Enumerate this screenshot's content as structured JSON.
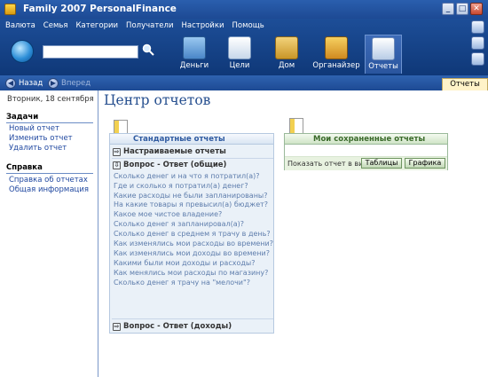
{
  "window": {
    "title": "Family 2007 PersonalFinance"
  },
  "menu": [
    "Валюта",
    "Семья",
    "Категории",
    "Получатели",
    "Настройки",
    "Помощь"
  ],
  "nav": [
    {
      "label": "Деньги",
      "icon": "money-icon"
    },
    {
      "label": "Цели",
      "icon": "goals-icon"
    },
    {
      "label": "Дом",
      "icon": "home-icon"
    },
    {
      "label": "Органайзер",
      "icon": "organizer-icon"
    },
    {
      "label": "Отчеты",
      "icon": "reports-icon",
      "active": true
    }
  ],
  "toolbar": {
    "back": "Назад",
    "forward": "Вперед",
    "tab": "Отчеты"
  },
  "sidebar": {
    "date": "Вторник, 18 сентября",
    "tasks_title": "Задачи",
    "tasks": [
      "Новый отчет",
      "Изменить отчет",
      "Удалить отчет"
    ],
    "help_title": "Справка",
    "help": [
      "Справка об отчетах",
      "Общая информация"
    ]
  },
  "main": {
    "title": "Центр отчетов",
    "standard": {
      "title": "Стандартные отчеты",
      "custom": "Настраиваемые отчеты",
      "qa_general": "Вопрос - Ответ (общие)",
      "questions": [
        "Сколько денег и на что я потратил(а)?",
        "Где и сколько я потратил(а) денег?",
        "Какие расходы не были запланированы?",
        "На какие товары я превысил(а) бюджет?",
        "Какое мое чистое владение?",
        "Сколько денег я запланировал(а)?",
        "Сколько денег в среднем я трачу в день?",
        "Как изменялись мои расходы во времени?",
        "Как изменялись мои доходы во времени?",
        "Какими были мои доходы и расходы?",
        "Как менялись мои расходы по магазину?",
        "Сколько денег я трачу на \"мелочи\"?"
      ],
      "qa_income": "Вопрос - Ответ (доходы)"
    },
    "saved": {
      "title": "Мои сохраненные отчеты",
      "show_label": "Показать отчет в виде:",
      "table_btn": "Таблицы",
      "chart_btn": "Графика"
    }
  }
}
